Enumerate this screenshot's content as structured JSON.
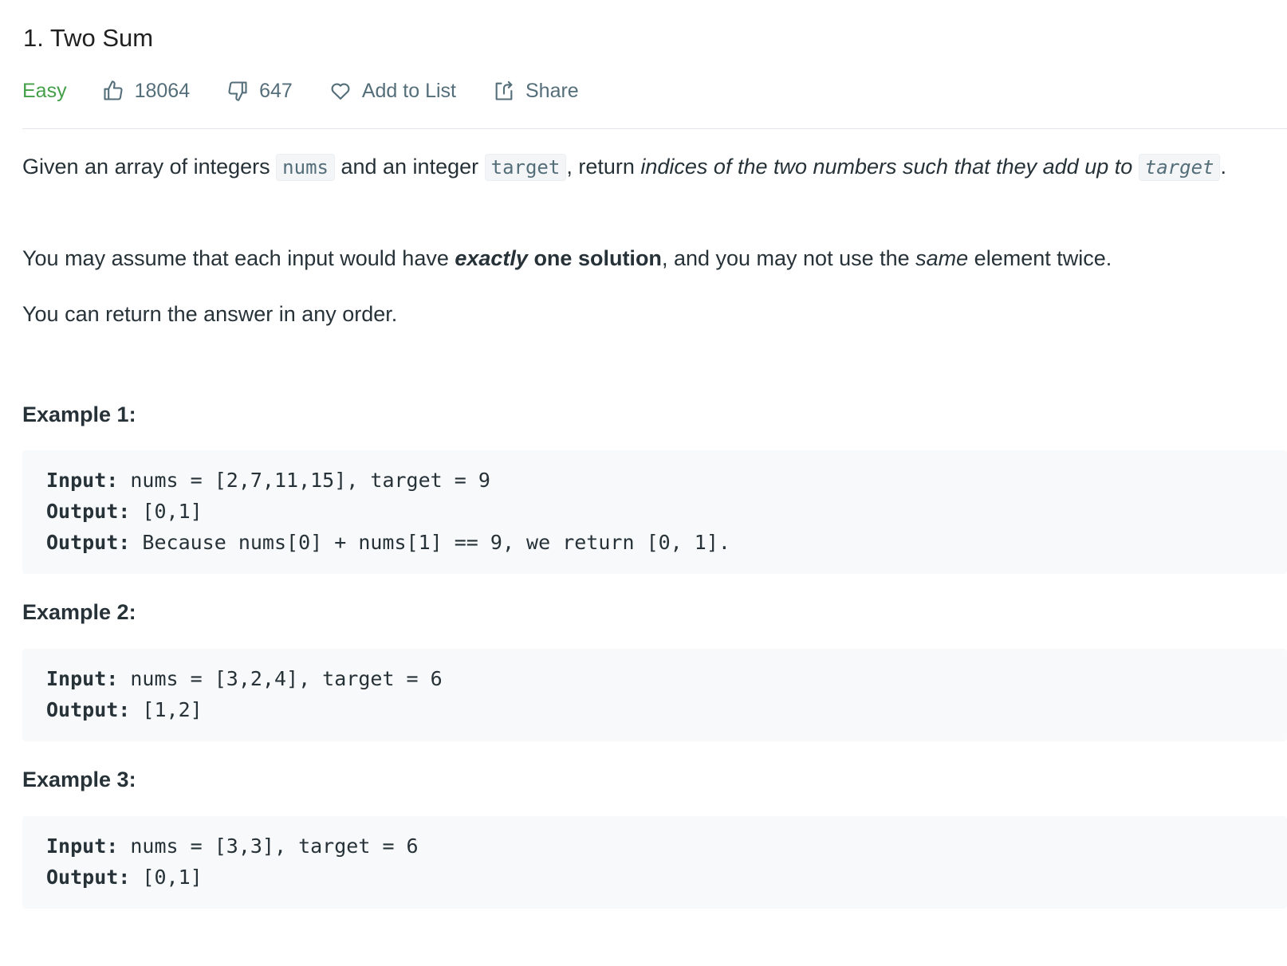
{
  "problem": {
    "title": "1. Two Sum",
    "difficulty": "Easy",
    "likes": "18064",
    "dislikes": "647",
    "add_to_list_label": "Add to List",
    "share_label": "Share"
  },
  "description": {
    "p1": {
      "t1": "Given an array of integers ",
      "code1": "nums",
      "t2": " and an integer ",
      "code2": "target",
      "t3": ", return ",
      "italic": "indices of the two numbers such that they add up to",
      "t4": " ",
      "code3": "target",
      "t5": "."
    },
    "p2": {
      "t1": "You may assume that each input would have ",
      "bold_italic": "exactly",
      "bold": " one solution",
      "t2": ", and you may not use the ",
      "italic": "same",
      "t3": " element twice."
    },
    "p3": "You can return the answer in any order."
  },
  "examples": [
    {
      "title": "Example 1:",
      "lines": [
        {
          "label": "Input:",
          "text": " nums = [2,7,11,15], target = 9"
        },
        {
          "label": "Output:",
          "text": " [0,1]"
        },
        {
          "label": "Output:",
          "text": " Because nums[0] + nums[1] == 9, we return [0, 1]."
        }
      ]
    },
    {
      "title": "Example 2:",
      "lines": [
        {
          "label": "Input:",
          "text": " nums = [3,2,4], target = 6"
        },
        {
          "label": "Output:",
          "text": " [1,2]"
        }
      ]
    },
    {
      "title": "Example 3:",
      "lines": [
        {
          "label": "Input:",
          "text": " nums = [3,3], target = 6"
        },
        {
          "label": "Output:",
          "text": " [0,1]"
        }
      ]
    }
  ],
  "colors": {
    "easy": "#43a047",
    "meta_text": "#546e7a",
    "code_bg": "#f7f9fa",
    "text": "#263238"
  },
  "icons": {
    "likes": "thumbs-up-icon",
    "dislikes": "thumbs-down-icon",
    "add_to_list": "heart-icon",
    "share": "share-icon"
  }
}
